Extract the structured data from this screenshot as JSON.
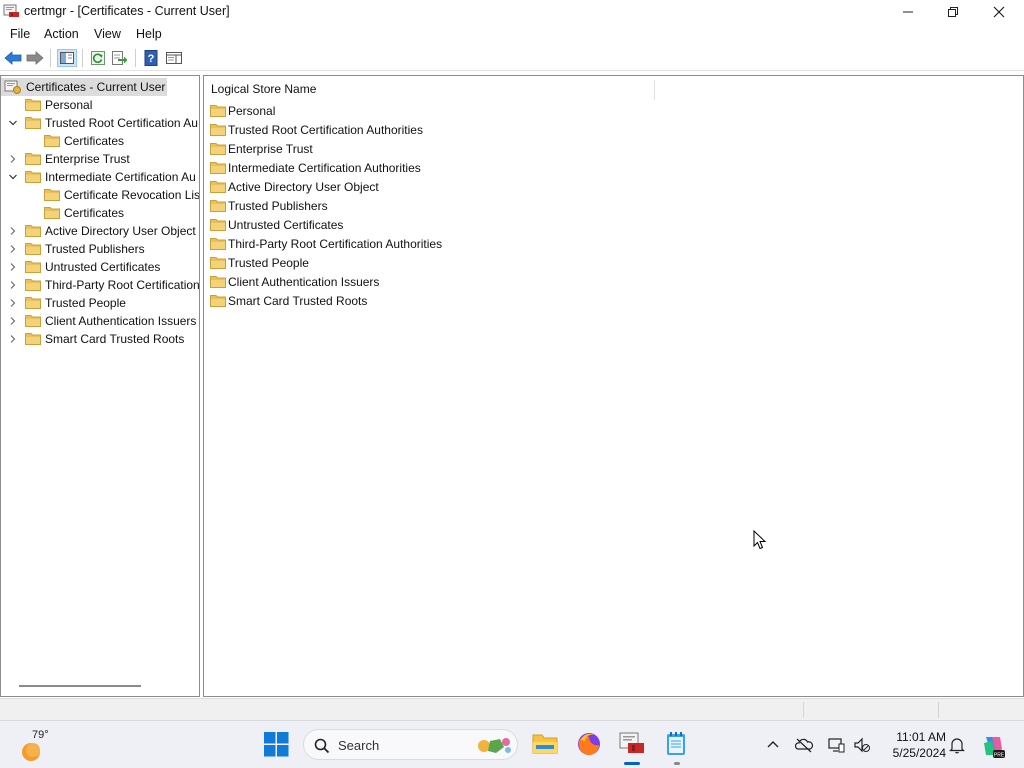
{
  "window": {
    "title": "certmgr - [Certificates - Current User]"
  },
  "menu": [
    "File",
    "Action",
    "View",
    "Help"
  ],
  "tree": {
    "root": "Certificates - Current User",
    "items": [
      {
        "label": "Personal",
        "expander": "none",
        "level": 1
      },
      {
        "label": "Trusted Root Certification Au",
        "expander": "expanded",
        "level": 1
      },
      {
        "label": "Certificates",
        "expander": "none",
        "level": 2
      },
      {
        "label": "Enterprise Trust",
        "expander": "collapsed",
        "level": 1
      },
      {
        "label": "Intermediate Certification Au",
        "expander": "expanded",
        "level": 1
      },
      {
        "label": "Certificate Revocation Lis",
        "expander": "none",
        "level": 2
      },
      {
        "label": "Certificates",
        "expander": "none",
        "level": 2
      },
      {
        "label": "Active Directory User Object",
        "expander": "collapsed",
        "level": 1
      },
      {
        "label": "Trusted Publishers",
        "expander": "collapsed",
        "level": 1
      },
      {
        "label": "Untrusted Certificates",
        "expander": "collapsed",
        "level": 1
      },
      {
        "label": "Third-Party Root Certification",
        "expander": "collapsed",
        "level": 1
      },
      {
        "label": "Trusted People",
        "expander": "collapsed",
        "level": 1
      },
      {
        "label": "Client Authentication Issuers",
        "expander": "collapsed",
        "level": 1
      },
      {
        "label": "Smart Card Trusted Roots",
        "expander": "collapsed",
        "level": 1
      }
    ]
  },
  "list": {
    "column_header": "Logical Store Name",
    "items": [
      "Personal",
      "Trusted Root Certification Authorities",
      "Enterprise Trust",
      "Intermediate Certification Authorities",
      "Active Directory User Object",
      "Trusted Publishers",
      "Untrusted Certificates",
      "Third-Party Root Certification Authorities",
      "Trusted People",
      "Client Authentication Issuers",
      "Smart Card Trusted Roots"
    ]
  },
  "taskbar": {
    "weather_temp": "79°",
    "search_placeholder": "Search",
    "time": "11:01 AM",
    "date": "5/25/2024"
  },
  "colors": {
    "folder": "#e8c15a",
    "folder_dark": "#c9a03a",
    "accent": "#0067c0",
    "tree_root_bg": "#dcdcdc"
  }
}
